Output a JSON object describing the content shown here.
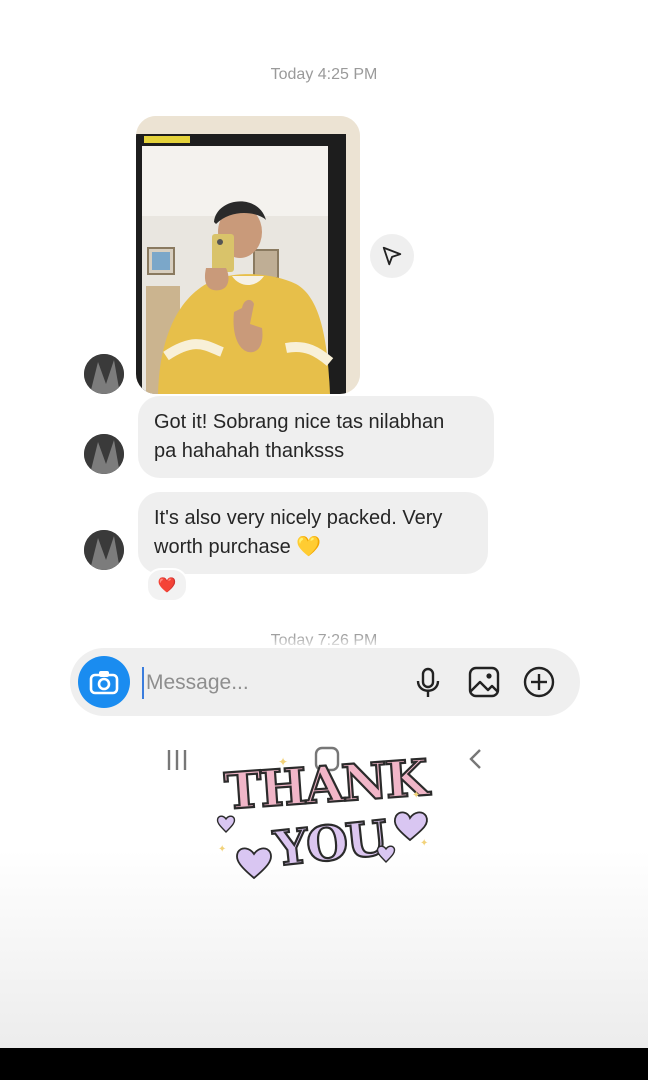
{
  "thread": {
    "timestamp_top": "Today 4:25 PM",
    "timestamp_bottom": "Today 7:26 PM",
    "messages": [
      {
        "type": "photo",
        "icon": "share-icon"
      },
      {
        "type": "text",
        "text_line1": "Got it! Sobrang nice tas nilabhan",
        "text_line2": "pa hahahah thanksss"
      },
      {
        "type": "text",
        "text_line1": "It's also very nicely packed. Very",
        "text_line2": "worth purchase 💛",
        "reaction": "❤️"
      }
    ]
  },
  "composer": {
    "placeholder": "Message...",
    "icons": [
      "camera-icon",
      "microphone-icon",
      "gallery-icon",
      "add-icon"
    ]
  },
  "navbar": {
    "icons": [
      "recents-icon",
      "home-icon",
      "back-icon"
    ]
  },
  "sticker": {
    "text": "THANK YOU"
  },
  "colors": {
    "accent": "#1a8cf0",
    "bubble": "#efefef",
    "sticker_pink": "#f1b6c8",
    "sticker_lilac": "#d9c6f2"
  }
}
